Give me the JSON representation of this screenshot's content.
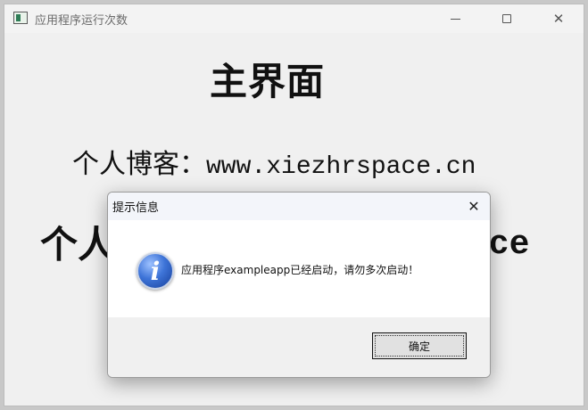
{
  "window": {
    "title": "应用程序运行次数",
    "controls": {
      "minimize": "minimize-icon",
      "maximize": "maximize-icon",
      "close": "close-icon"
    }
  },
  "main": {
    "heading": "主界面",
    "blog_label": "个人博客：",
    "blog_url": "www.xiezhrspace.cn",
    "big_line_start": "个人",
    "big_line_end": "ace"
  },
  "dialog": {
    "title": "提示信息",
    "icon": "info-icon",
    "message": "应用程序exampleapp已经启动，请勿多次启动！",
    "ok_label": "确定",
    "close_glyph": "✕"
  },
  "colors": {
    "window_bg": "#f0f0f0",
    "dialog_bg": "#ffffff",
    "info_icon_blue": "#3e74d8"
  }
}
